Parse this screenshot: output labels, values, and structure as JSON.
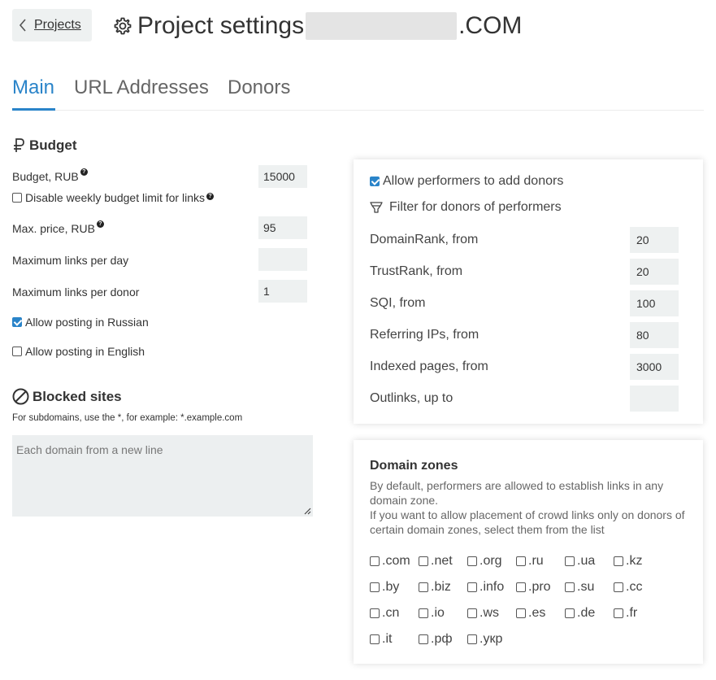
{
  "header": {
    "back_label": "Projects",
    "title_prefix": "Project settings",
    "title_suffix": ".COM"
  },
  "tabs": [
    {
      "label": "Main",
      "active": true
    },
    {
      "label": "URL Addresses",
      "active": false
    },
    {
      "label": "Donors",
      "active": false
    }
  ],
  "budget": {
    "section_title": "Budget",
    "budget_label": "Budget, RUB",
    "budget_value": "15000",
    "disable_weekly_label": "Disable weekly budget limit for links",
    "disable_weekly_checked": false,
    "max_price_label": "Max. price, RUB",
    "max_price_value": "95",
    "max_links_day_label": "Maximum links per day",
    "max_links_day_value": "",
    "max_links_donor_label": "Maximum links per donor",
    "max_links_donor_value": "1",
    "allow_russian_label": "Allow posting in Russian",
    "allow_russian_checked": true,
    "allow_english_label": "Allow posting in English",
    "allow_english_checked": false
  },
  "blocked": {
    "section_title": "Blocked sites",
    "hint": "For subdomains, use the *, for example: *.example.com",
    "placeholder": "Each domain from a new line"
  },
  "donors_panel": {
    "allow_add_label": "Allow performers to add donors",
    "allow_add_checked": true,
    "filter_title": "Filter for donors of performers",
    "filters": [
      {
        "label": "DomainRank, from",
        "value": "20"
      },
      {
        "label": "TrustRank, from",
        "value": "20"
      },
      {
        "label": "SQI, from",
        "value": "100"
      },
      {
        "label": "Referring IPs, from",
        "value": "80"
      },
      {
        "label": "Indexed pages, from",
        "value": "3000"
      },
      {
        "label": "Outlinks, up to",
        "value": ""
      }
    ]
  },
  "domain_zones": {
    "title": "Domain zones",
    "desc1": "By default, performers are allowed to establish links in any domain zone.",
    "desc2": "If you want to allow placement of crowd links only on donors of certain domain zones, select them from the list",
    "zones": [
      ".com",
      ".net",
      ".org",
      ".ru",
      ".ua",
      ".kz",
      ".by",
      ".biz",
      ".info",
      ".pro",
      ".su",
      ".cc",
      ".cn",
      ".io",
      ".ws",
      ".es",
      ".de",
      ".fr",
      ".it",
      ".рф",
      ".укр"
    ]
  },
  "colors": {
    "accent": "#2a84c9",
    "input_bg": "#eef1f1"
  }
}
